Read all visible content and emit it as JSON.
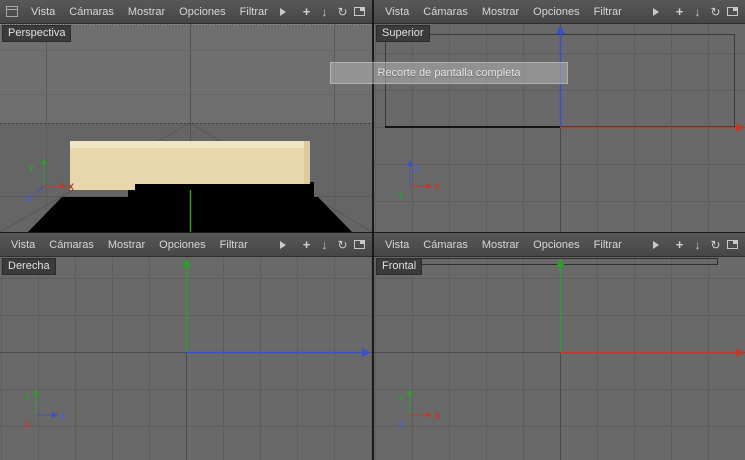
{
  "menu": {
    "items": [
      "Vista",
      "Cámaras",
      "Mostrar",
      "Opciones",
      "Filtrar"
    ],
    "icon_glyphs": {
      "pan": "+",
      "zoom": "↓",
      "rotate": "↻"
    }
  },
  "viewports": {
    "perspective": {
      "label": "Perspectiva"
    },
    "top": {
      "label": "Superior"
    },
    "right": {
      "label": "Derecha"
    },
    "front": {
      "label": "Frontal"
    }
  },
  "overlay": {
    "text": "Recorte de pantalla completa"
  },
  "axes": {
    "x": "X",
    "y": "Y",
    "z": "Z"
  },
  "colors": {
    "axis_x": "#c03a2a",
    "axis_y": "#2f9e2f",
    "axis_z": "#3a52c8",
    "viewport_bg": "#696969",
    "menubar_bg": "#4e4e4e",
    "object_beige": "#e7d7ab",
    "floor_black": "#000000"
  }
}
